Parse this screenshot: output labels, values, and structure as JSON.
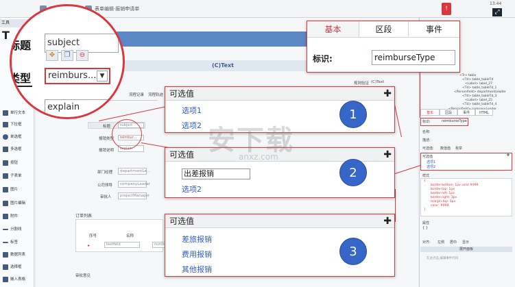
{
  "topbar": {
    "tabs": [
      "流程管理",
      "表单编辑·报销申请单"
    ],
    "time": "13:44",
    "notice_badge": "!"
  },
  "left_toolbar": {
    "header": "工具",
    "tools": [
      "单行文本",
      "下拉框",
      "单选框",
      "多选框",
      "按钮",
      "子表单",
      "图片",
      "图片编辑",
      "附件",
      "分割线",
      "标签",
      "数据列表",
      "选择框",
      "嵌入表格"
    ]
  },
  "canvas": {
    "title_bar": "(C)Text",
    "subtabs": [
      "流程记录",
      "流程轨迹"
    ],
    "right_tabs": [
      "规则验证",
      "(C)Text"
    ],
    "form_rows": [
      {
        "label": "标题",
        "value": "subject"
      },
      {
        "label": "报销类型",
        "value": "reimbur..."
      },
      {
        "label": "报销说明",
        "value": "explain"
      },
      {
        "label": "部门经理",
        "value": "departmentLe..."
      },
      {
        "label": "公司领导",
        "value": "companyLeader"
      },
      {
        "label": "审批人",
        "value": "projectManager"
      }
    ],
    "table": {
      "title": "订单列表",
      "headers": [
        "序号",
        "名称"
      ],
      "row": [
        "序号",
        "textfield",
        "number"
      ]
    },
    "footer_label": "审批意见"
  },
  "magnifier": {
    "label_title": "标题",
    "label_type": "类型",
    "input_subject": "subject",
    "input_type": "reimburs...",
    "input_explain": "explain"
  },
  "property_tabs": {
    "tabs": [
      "基本",
      "区段",
      "事件"
    ],
    "label": "标识:",
    "value": "reimburseType"
  },
  "right_panel": {
    "tree": [
      "<Table> tableTd_8",
      "<Label> label_10",
      "<Td> table_3_tableTd_9",
      "<Textarea> explain",
      "<Tr> table",
      "<Td> table_tableTd",
      "<Label> label_27",
      "<Td> table_tableTd_1",
      "<Personfield> departmentLeader",
      "<Td> table_tableTd_3",
      "<Label> label_25",
      "<Td> table_tableTd_4",
      "<Personfield> companyLeader"
    ],
    "tabs": [
      "基本",
      "区段",
      "事件",
      "HTML"
    ],
    "id_label": "标识:",
    "id_value": "reimburseType",
    "name_label": "名称:",
    "desc_label": "描述:",
    "validate_label": "可选值:",
    "radio1": "数值值",
    "radio2": "枚举",
    "opts_label": "可选值",
    "opts": [
      "选项1",
      "选项2"
    ],
    "style_label": "样式",
    "css": [
      "{",
      "border-bottom: 1px solid #999",
      "border-top: 1px",
      "border-left: 1px",
      "border-right: 1px",
      "margin-top: 1px",
      "color: #999",
      "}"
    ],
    "prop_label": "属性",
    "brace": "{ }",
    "align_label": "对齐:",
    "align_opts": [
      "左侧",
      "居中",
      "显示"
    ],
    "bottom_bar": "展开面板",
    "bottom_hint": "在此点击,编辑事件代码"
  },
  "popups": [
    {
      "title": "可选值",
      "options": [
        "选项1",
        "选项2"
      ],
      "badge": "1"
    },
    {
      "title": "可选值",
      "input": "出差报销",
      "options": [
        "选项2"
      ],
      "badge": "2"
    },
    {
      "title": "可选值",
      "options": [
        "差旅报销",
        "费用报销",
        "其他报销"
      ],
      "badge": "3"
    }
  ],
  "watermark": {
    "main": "安下载",
    "sub": "anxz.com"
  },
  "colors": {
    "accent": "#d9363e",
    "badge": "#3566c8",
    "option": "#2f5bd6",
    "band": "#5b87c4"
  }
}
